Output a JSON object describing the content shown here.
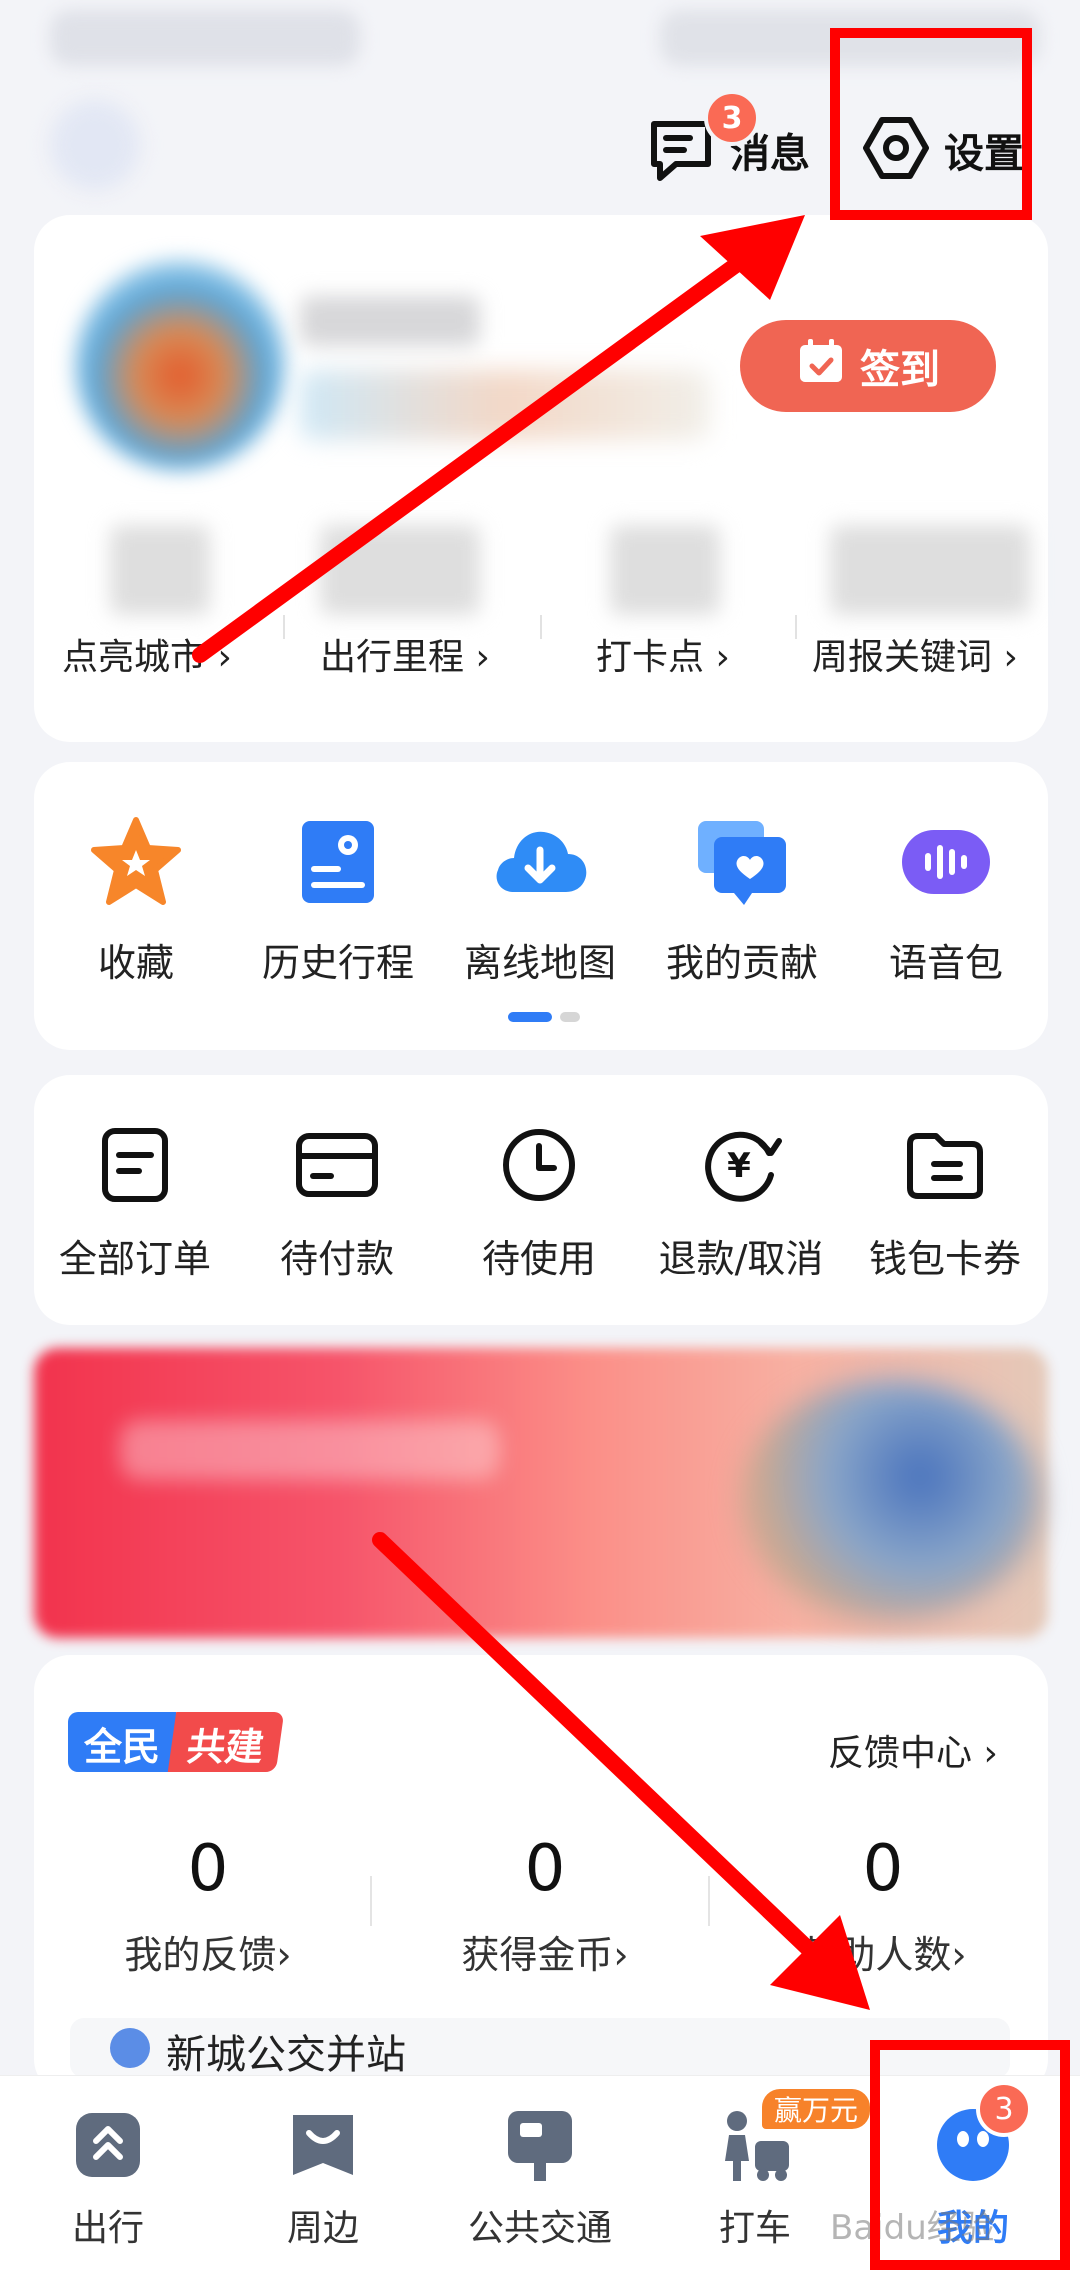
{
  "header": {
    "messages_label": "消息",
    "messages_badge": "3",
    "settings_label": "设置"
  },
  "profile": {
    "checkin_label": "签到",
    "stats": [
      {
        "label": "点亮城市"
      },
      {
        "label": "出行里程"
      },
      {
        "label": "打卡点"
      },
      {
        "label": "周报关键词"
      }
    ]
  },
  "shortcuts": [
    {
      "label": "收藏",
      "icon": "star-icon"
    },
    {
      "label": "历史行程",
      "icon": "history-trip-icon"
    },
    {
      "label": "离线地图",
      "icon": "cloud-download-icon"
    },
    {
      "label": "我的贡献",
      "icon": "contribution-chat-icon"
    },
    {
      "label": "语音包",
      "icon": "voice-pack-icon"
    }
  ],
  "orders": [
    {
      "label": "全部订单",
      "icon": "order-list-icon"
    },
    {
      "label": "待付款",
      "icon": "card-icon"
    },
    {
      "label": "待使用",
      "icon": "clock-icon"
    },
    {
      "label": "退款/取消",
      "icon": "refund-yuan-icon"
    },
    {
      "label": "钱包卡券",
      "icon": "wallet-icon"
    }
  ],
  "feedback": {
    "tag_left": "全民",
    "tag_right": "共建",
    "center_link": "反馈中心",
    "stats": [
      {
        "value": "0",
        "label": "我的反馈"
      },
      {
        "value": "0",
        "label": "获得金币"
      },
      {
        "value": "0",
        "label": "帮助人数"
      }
    ],
    "partial_text": "新城公交并站"
  },
  "tabs": [
    {
      "label": "出行",
      "icon": "travel-icon"
    },
    {
      "label": "周边",
      "icon": "nearby-icon"
    },
    {
      "label": "公共交通",
      "icon": "bus-icon"
    },
    {
      "label": "打车",
      "icon": "taxi-icon",
      "promo": "赢万元"
    },
    {
      "label": "我的",
      "icon": "profile-icon",
      "badge": "3",
      "active": true
    }
  ],
  "watermark": "Baidu经验",
  "colors": {
    "accent_red": "#f06553",
    "primary_blue": "#2f7cf6",
    "annotation_red": "#ff0000"
  }
}
